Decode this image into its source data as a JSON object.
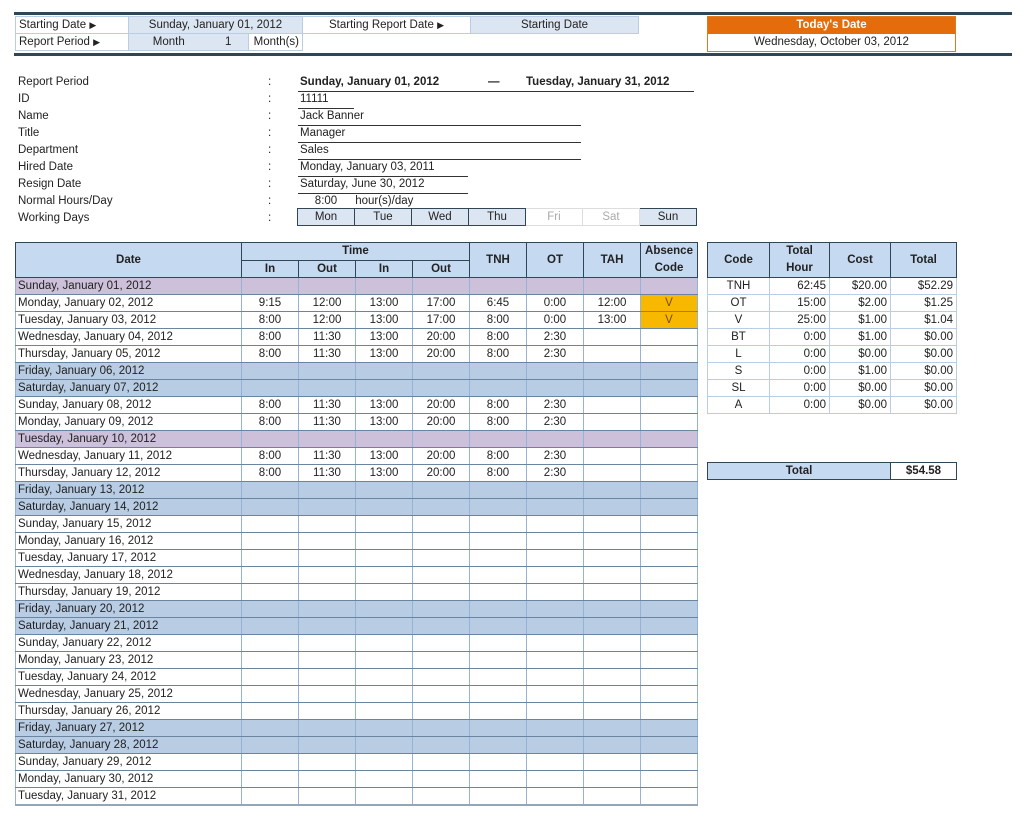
{
  "settings": {
    "starting_date_label": "Starting Date",
    "starting_date_value": "Sunday, January 01, 2012",
    "starting_report_date_label": "Starting Report Date",
    "starting_report_date_value": "Starting Date",
    "report_period_label": "Report Period",
    "report_period_unit": "Month",
    "report_period_count": "1",
    "report_period_suffix": "Month(s)",
    "arrow_glyph": "▶"
  },
  "today": {
    "label": "Today's Date",
    "value": "Wednesday, October 03, 2012"
  },
  "info": {
    "colon": ":",
    "report_period_label": "Report Period",
    "report_period_start": "Sunday, January 01, 2012",
    "report_period_sep": "—",
    "report_period_end": "Tuesday, January 31, 2012",
    "id_label": "ID",
    "id_value": "11111",
    "name_label": "Name",
    "name_value": "Jack Banner",
    "title_label": "Title",
    "title_value": "Manager",
    "department_label": "Department",
    "department_value": "Sales",
    "hired_label": "Hired Date",
    "hired_value": "Monday, January 03, 2011",
    "resign_label": "Resign Date",
    "resign_value": "Saturday, June 30, 2012",
    "hours_label": "Normal Hours/Day",
    "hours_value": "8:00",
    "hours_unit": "hour(s)/day",
    "working_days_label": "Working Days",
    "working_days": [
      {
        "day": "Mon",
        "on": true
      },
      {
        "day": "Tue",
        "on": true
      },
      {
        "day": "Wed",
        "on": true
      },
      {
        "day": "Thu",
        "on": true
      },
      {
        "day": "Fri",
        "on": false
      },
      {
        "day": "Sat",
        "on": false
      },
      {
        "day": "Sun",
        "on": true
      }
    ]
  },
  "timesheet": {
    "headers": {
      "date": "Date",
      "time": "Time",
      "in1": "In",
      "out1": "Out",
      "in2": "In",
      "out2": "Out",
      "tnh": "TNH",
      "ot": "OT",
      "tah": "TAH",
      "absence_line1": "Absence",
      "absence_line2": "Code"
    },
    "rows": [
      {
        "date": "Sunday, January 01, 2012",
        "type": "purple",
        "in1": "",
        "out1": "",
        "in2": "",
        "out2": "",
        "tnh": "",
        "ot": "",
        "tah": "",
        "abs": ""
      },
      {
        "date": "Monday, January 02, 2012",
        "type": "normal",
        "in1": "9:15",
        "out1": "12:00",
        "in2": "13:00",
        "out2": "17:00",
        "tnh": "6:45",
        "ot": "0:00",
        "tah": "12:00",
        "abs": "V"
      },
      {
        "date": "Tuesday, January 03, 2012",
        "type": "normal",
        "in1": "8:00",
        "out1": "12:00",
        "in2": "13:00",
        "out2": "17:00",
        "tnh": "8:00",
        "ot": "0:00",
        "tah": "13:00",
        "abs": "V"
      },
      {
        "date": "Wednesday, January 04, 2012",
        "type": "normal",
        "in1": "8:00",
        "out1": "11:30",
        "in2": "13:00",
        "out2": "20:00",
        "tnh": "8:00",
        "ot": "2:30",
        "tah": "",
        "abs": ""
      },
      {
        "date": "Thursday, January 05, 2012",
        "type": "normal",
        "in1": "8:00",
        "out1": "11:30",
        "in2": "13:00",
        "out2": "20:00",
        "tnh": "8:00",
        "ot": "2:30",
        "tah": "",
        "abs": ""
      },
      {
        "date": "Friday, January 06, 2012",
        "type": "blue",
        "in1": "",
        "out1": "",
        "in2": "",
        "out2": "",
        "tnh": "",
        "ot": "",
        "tah": "",
        "abs": ""
      },
      {
        "date": "Saturday, January 07, 2012",
        "type": "blue",
        "in1": "",
        "out1": "",
        "in2": "",
        "out2": "",
        "tnh": "",
        "ot": "",
        "tah": "",
        "abs": ""
      },
      {
        "date": "Sunday, January 08, 2012",
        "type": "normal",
        "in1": "8:00",
        "out1": "11:30",
        "in2": "13:00",
        "out2": "20:00",
        "tnh": "8:00",
        "ot": "2:30",
        "tah": "",
        "abs": ""
      },
      {
        "date": "Monday, January 09, 2012",
        "type": "normal",
        "in1": "8:00",
        "out1": "11:30",
        "in2": "13:00",
        "out2": "20:00",
        "tnh": "8:00",
        "ot": "2:30",
        "tah": "",
        "abs": ""
      },
      {
        "date": "Tuesday, January 10, 2012",
        "type": "purple",
        "in1": "",
        "out1": "",
        "in2": "",
        "out2": "",
        "tnh": "",
        "ot": "",
        "tah": "",
        "abs": ""
      },
      {
        "date": "Wednesday, January 11, 2012",
        "type": "normal",
        "in1": "8:00",
        "out1": "11:30",
        "in2": "13:00",
        "out2": "20:00",
        "tnh": "8:00",
        "ot": "2:30",
        "tah": "",
        "abs": ""
      },
      {
        "date": "Thursday, January 12, 2012",
        "type": "normal",
        "in1": "8:00",
        "out1": "11:30",
        "in2": "13:00",
        "out2": "20:00",
        "tnh": "8:00",
        "ot": "2:30",
        "tah": "",
        "abs": ""
      },
      {
        "date": "Friday, January 13, 2012",
        "type": "blue",
        "in1": "",
        "out1": "",
        "in2": "",
        "out2": "",
        "tnh": "",
        "ot": "",
        "tah": "",
        "abs": ""
      },
      {
        "date": "Saturday, January 14, 2012",
        "type": "blue",
        "in1": "",
        "out1": "",
        "in2": "",
        "out2": "",
        "tnh": "",
        "ot": "",
        "tah": "",
        "abs": ""
      },
      {
        "date": "Sunday, January 15, 2012",
        "type": "normal",
        "in1": "",
        "out1": "",
        "in2": "",
        "out2": "",
        "tnh": "",
        "ot": "",
        "tah": "",
        "abs": ""
      },
      {
        "date": "Monday, January 16, 2012",
        "type": "normal",
        "in1": "",
        "out1": "",
        "in2": "",
        "out2": "",
        "tnh": "",
        "ot": "",
        "tah": "",
        "abs": ""
      },
      {
        "date": "Tuesday, January 17, 2012",
        "type": "normal",
        "in1": "",
        "out1": "",
        "in2": "",
        "out2": "",
        "tnh": "",
        "ot": "",
        "tah": "",
        "abs": ""
      },
      {
        "date": "Wednesday, January 18, 2012",
        "type": "normal",
        "in1": "",
        "out1": "",
        "in2": "",
        "out2": "",
        "tnh": "",
        "ot": "",
        "tah": "",
        "abs": ""
      },
      {
        "date": "Thursday, January 19, 2012",
        "type": "normal",
        "in1": "",
        "out1": "",
        "in2": "",
        "out2": "",
        "tnh": "",
        "ot": "",
        "tah": "",
        "abs": ""
      },
      {
        "date": "Friday, January 20, 2012",
        "type": "blue",
        "in1": "",
        "out1": "",
        "in2": "",
        "out2": "",
        "tnh": "",
        "ot": "",
        "tah": "",
        "abs": ""
      },
      {
        "date": "Saturday, January 21, 2012",
        "type": "blue",
        "in1": "",
        "out1": "",
        "in2": "",
        "out2": "",
        "tnh": "",
        "ot": "",
        "tah": "",
        "abs": ""
      },
      {
        "date": "Sunday, January 22, 2012",
        "type": "normal",
        "in1": "",
        "out1": "",
        "in2": "",
        "out2": "",
        "tnh": "",
        "ot": "",
        "tah": "",
        "abs": ""
      },
      {
        "date": "Monday, January 23, 2012",
        "type": "normal",
        "in1": "",
        "out1": "",
        "in2": "",
        "out2": "",
        "tnh": "",
        "ot": "",
        "tah": "",
        "abs": ""
      },
      {
        "date": "Tuesday, January 24, 2012",
        "type": "normal",
        "in1": "",
        "out1": "",
        "in2": "",
        "out2": "",
        "tnh": "",
        "ot": "",
        "tah": "",
        "abs": ""
      },
      {
        "date": "Wednesday, January 25, 2012",
        "type": "normal",
        "in1": "",
        "out1": "",
        "in2": "",
        "out2": "",
        "tnh": "",
        "ot": "",
        "tah": "",
        "abs": ""
      },
      {
        "date": "Thursday, January 26, 2012",
        "type": "normal",
        "in1": "",
        "out1": "",
        "in2": "",
        "out2": "",
        "tnh": "",
        "ot": "",
        "tah": "",
        "abs": ""
      },
      {
        "date": "Friday, January 27, 2012",
        "type": "blue",
        "in1": "",
        "out1": "",
        "in2": "",
        "out2": "",
        "tnh": "",
        "ot": "",
        "tah": "",
        "abs": ""
      },
      {
        "date": "Saturday, January 28, 2012",
        "type": "blue",
        "in1": "",
        "out1": "",
        "in2": "",
        "out2": "",
        "tnh": "",
        "ot": "",
        "tah": "",
        "abs": ""
      },
      {
        "date": "Sunday, January 29, 2012",
        "type": "normal",
        "in1": "",
        "out1": "",
        "in2": "",
        "out2": "",
        "tnh": "",
        "ot": "",
        "tah": "",
        "abs": ""
      },
      {
        "date": "Monday, January 30, 2012",
        "type": "normal",
        "in1": "",
        "out1": "",
        "in2": "",
        "out2": "",
        "tnh": "",
        "ot": "",
        "tah": "",
        "abs": ""
      },
      {
        "date": "Tuesday, January 31, 2012",
        "type": "normal",
        "in1": "",
        "out1": "",
        "in2": "",
        "out2": "",
        "tnh": "",
        "ot": "",
        "tah": "",
        "abs": ""
      }
    ]
  },
  "summary": {
    "headers": {
      "code": "Code",
      "total_hour_line1": "Total",
      "total_hour_line2": "Hour",
      "cost": "Cost",
      "total": "Total"
    },
    "rows": [
      {
        "code": "TNH",
        "hours": "62:45",
        "cost": "$20.00",
        "total": "$52.29"
      },
      {
        "code": "OT",
        "hours": "15:00",
        "cost": "$2.00",
        "total": "$1.25"
      },
      {
        "code": "V",
        "hours": "25:00",
        "cost": "$1.00",
        "total": "$1.04"
      },
      {
        "code": "BT",
        "hours": "0:00",
        "cost": "$1.00",
        "total": "$0.00"
      },
      {
        "code": "L",
        "hours": "0:00",
        "cost": "$0.00",
        "total": "$0.00"
      },
      {
        "code": "S",
        "hours": "0:00",
        "cost": "$1.00",
        "total": "$0.00"
      },
      {
        "code": "SL",
        "hours": "0:00",
        "cost": "$0.00",
        "total": "$0.00"
      },
      {
        "code": "A",
        "hours": "0:00",
        "cost": "$0.00",
        "total": "$0.00"
      }
    ],
    "grand_total_label": "Total",
    "grand_total_value": "$54.58"
  },
  "colors": {
    "header_fill": "#c5d9f1",
    "weekend_fill": "#b8cce4",
    "holiday_fill": "#ccc0da",
    "absence_fill": "#f9b800",
    "today_header": "#e46c0a",
    "dark_border": "#2f4656"
  }
}
